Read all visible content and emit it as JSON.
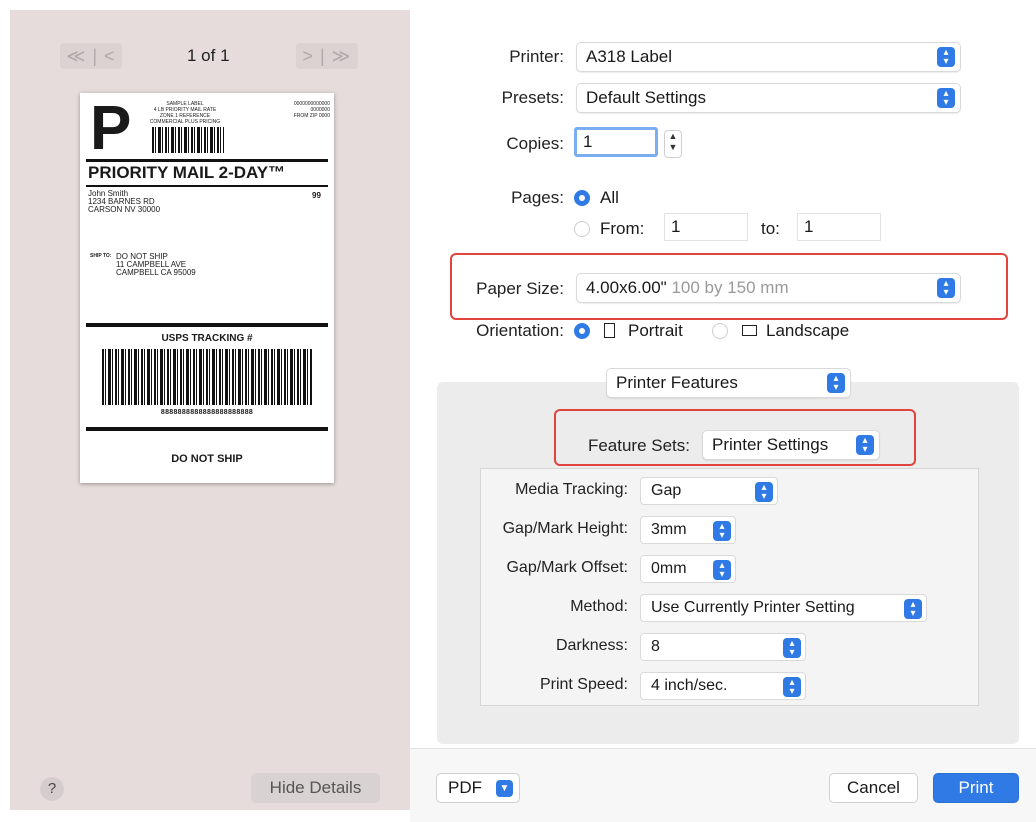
{
  "preview": {
    "page_indicator": "1 of 1",
    "prev_nav": "≪ | <",
    "next_nav": "> | ≫",
    "label": {
      "big_letter": "P",
      "top_lines": [
        "SAMPLE LABEL",
        "4 LB PRIORITY MAIL RATE",
        "ZONE 1 REFERENCE",
        "COMMERCIAL PLUS PRICING"
      ],
      "code_lines": [
        "0000000000000",
        "0000000",
        "FROM ZIP 0000"
      ],
      "service": "PRIORITY MAIL 2-DAY™",
      "sender": [
        "John Smith",
        "1234 BARNES RD",
        "CARSON NV 30000"
      ],
      "code99": "99",
      "ship_to_label": "SHIP TO:",
      "recipient": [
        "DO NOT SHIP",
        "11 CAMPBELL AVE",
        "CAMPBELL CA 95009"
      ],
      "tracking_title": "USPS TRACKING #",
      "tracking_number": "8888888888888888888888",
      "footer": "DO NOT SHIP"
    },
    "help_label": "?",
    "hide_details_label": "Hide Details"
  },
  "print": {
    "printer": {
      "label": "Printer:",
      "value": "A318 Label"
    },
    "presets": {
      "label": "Presets:",
      "value": "Default Settings"
    },
    "copies": {
      "label": "Copies:",
      "value": "1"
    },
    "pages": {
      "label": "Pages:",
      "all": "All",
      "from_label": "From:",
      "from_value": "1",
      "to_label": "to:",
      "to_value": "1"
    },
    "paper_size": {
      "label": "Paper Size:",
      "value": "4.00x6.00\"",
      "detail": "100 by 150 mm"
    },
    "orientation": {
      "label": "Orientation:",
      "portrait": "Portrait",
      "landscape": "Landscape"
    },
    "section_popup": "Printer Features",
    "feature_sets": {
      "label": "Feature Sets:",
      "value": "Printer Settings"
    },
    "features": [
      {
        "label": "Media Tracking:",
        "value": "Gap"
      },
      {
        "label": "Gap/Mark Height:",
        "value": "3mm"
      },
      {
        "label": "Gap/Mark Offset:",
        "value": "0mm"
      },
      {
        "label": "Method:",
        "value": "Use Currently Printer Setting"
      },
      {
        "label": "Darkness:",
        "value": "8"
      },
      {
        "label": "Print Speed:",
        "value": "4 inch/sec."
      }
    ]
  },
  "footer": {
    "pdf_label": "PDF",
    "cancel_label": "Cancel",
    "print_label": "Print"
  },
  "colors": {
    "accent": "#2f7ae5",
    "highlight": "#e0443a",
    "preview_bg": "#e6dcdc"
  }
}
